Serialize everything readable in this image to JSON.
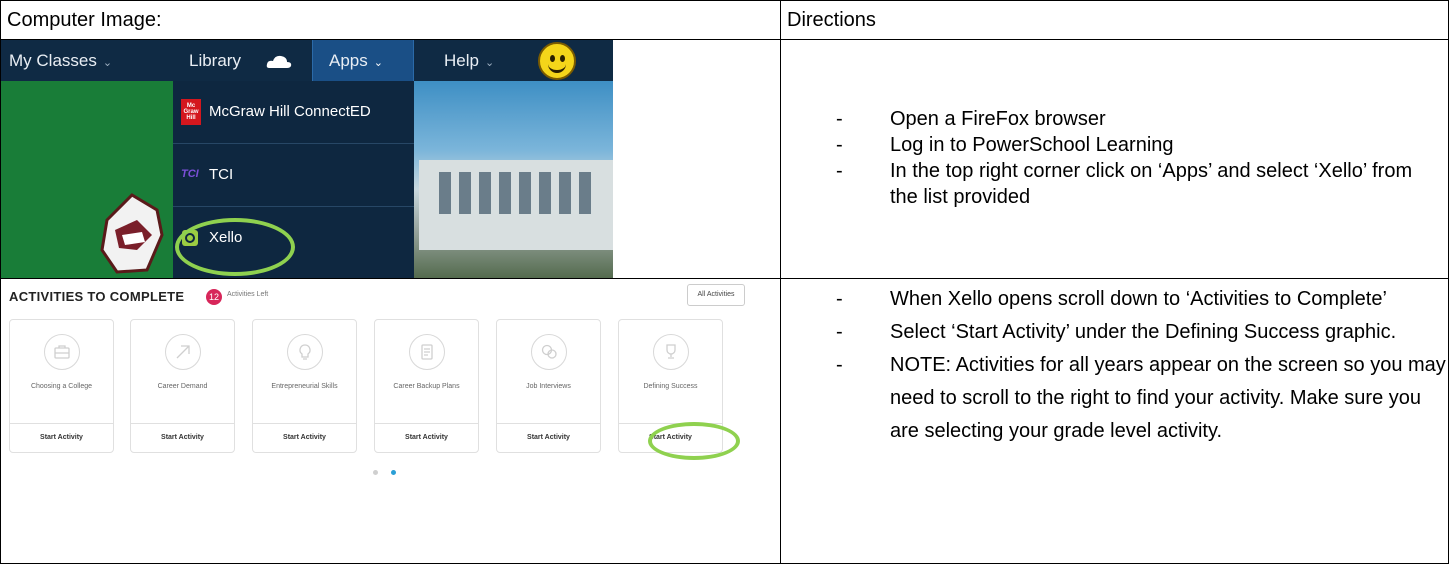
{
  "table": {
    "header_left": "Computer Image:",
    "header_right": "Directions"
  },
  "shot1": {
    "nav": {
      "my_classes": "My Classes",
      "library": "Library",
      "apps": "Apps",
      "help": "Help"
    },
    "apps_menu": [
      {
        "label": "McGraw Hill ConnectED",
        "icon": "mcgraw-hill-logo"
      },
      {
        "label": "TCI",
        "icon": "tci-logo"
      },
      {
        "label": "Xello",
        "icon": "xello-logo"
      }
    ],
    "mh_logo_text": "Mc Graw Hill",
    "tci_logo_text": "TCI",
    "highlight_color": "#8fd14f"
  },
  "directions1": [
    "Open a FireFox browser",
    "Log in to PowerSchool Learning",
    "In the top right corner click on ‘Apps’ and select ‘Xello’ from the list provided"
  ],
  "shot2": {
    "title": "ACTIVITIES TO COMPLETE",
    "badge": "12",
    "activities_left": "Activities Left",
    "all_activities": "All Activities",
    "cards": [
      {
        "name": "Choosing a College",
        "icon": "briefcase-icon",
        "button": "Start Activity"
      },
      {
        "name": "Career Demand",
        "icon": "arrow-up-right-icon",
        "button": "Start Activity"
      },
      {
        "name": "Entrepreneurial Skills",
        "icon": "lightbulb-icon",
        "button": "Start Activity"
      },
      {
        "name": "Career Backup Plans",
        "icon": "document-icon",
        "button": "Start Activity"
      },
      {
        "name": "Job Interviews",
        "icon": "chat-bubbles-icon",
        "button": "Start Activity"
      },
      {
        "name": "Defining Success",
        "icon": "trophy-icon",
        "button": "Start Activity"
      }
    ],
    "pagination_active": 2,
    "pagination_total": 2
  },
  "directions2": [
    "When Xello opens scroll down to ‘Activities to Complete’",
    "Select ‘Start Activity’ under the Defining Success graphic.",
    "NOTE: Activities for all years appear on the screen so you may need to scroll to the right to find your activity. Make sure you are selecting your grade level activity."
  ]
}
